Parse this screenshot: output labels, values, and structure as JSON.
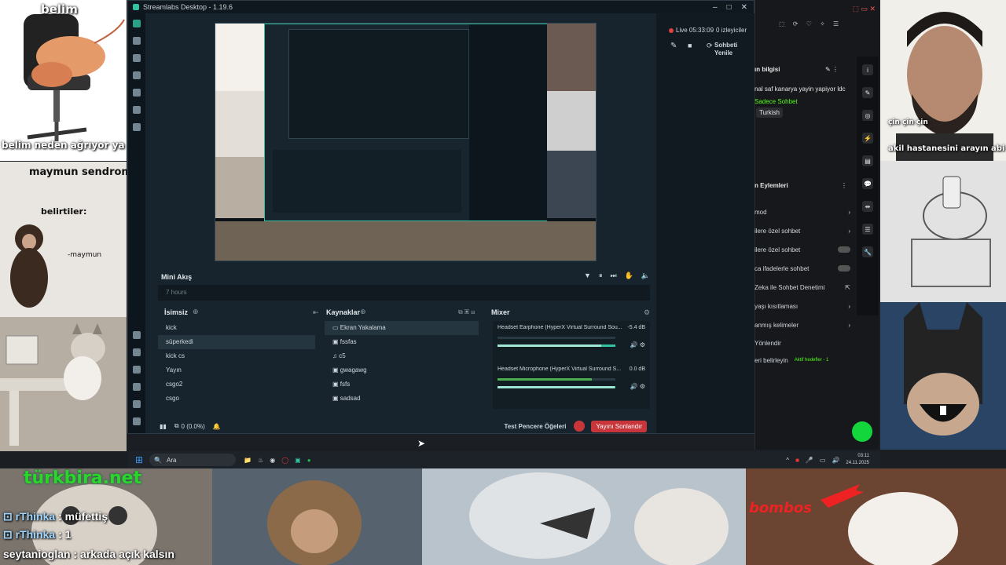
{
  "memes": {
    "shrimp_top": "belim",
    "shrimp_bottom": "belim neden ağrıyor ya",
    "monkey_title": "maymun sendromu",
    "monkey_symptoms": "belirtiler:",
    "monkey_sign": "-maymun",
    "turkbira": "türkbira.net",
    "bombos": "bombos",
    "akil": "akil hastanesini arayın abi",
    "cin": "çin çin çin"
  },
  "chat": [
    {
      "user": "rThinka",
      "msg": "müfettiş"
    },
    {
      "user": "rThinka",
      "msg": "1"
    },
    {
      "user": "seytanioglan",
      "msg": "arkada açık kalsın"
    }
  ],
  "app": {
    "title": "Streamlabs Desktop - 1.19.6",
    "live": "Live 05:33:09",
    "viewers": "0 izleyiciler",
    "refresh_chat": "Sohbeti Yenile"
  },
  "mini_feed": {
    "title": "Mini Akış",
    "empty_text": "7 hours"
  },
  "scenes": {
    "title": "İsimsiz",
    "items": [
      "kick",
      "süperkedi",
      "kick cs",
      "Yayın",
      "csgo2",
      "csgo"
    ]
  },
  "sources": {
    "title": "Kaynaklar",
    "items": [
      "Ekran Yakalama",
      "fssfas",
      "c5",
      "gwagawg",
      "fsfs",
      "sadsad"
    ]
  },
  "mixer": {
    "title": "Mixer",
    "channels": [
      {
        "name": "Headset Earphone (HyperX Virtual Surround Sou...",
        "db": "-5.4 dB",
        "level": 0.88
      },
      {
        "name": "Headset Microphone (HyperX Virtual Surround S...",
        "db": "0.0 dB",
        "level": 0.99
      }
    ]
  },
  "footer": {
    "cpu": "0 (0.0%)",
    "test_label": "Test Pencere Öğeleri",
    "stop_button": "Yayını Sonlandır"
  },
  "taskbar": {
    "search": "Ara",
    "time": "03:11",
    "date": "24.11.2025"
  },
  "kick": {
    "stream_info": "ın bilgisi",
    "stream_title": "nal saf kanarya yayin yapiyor ldc",
    "chat_only": "Sadece Sohbet",
    "language": "Turkish",
    "actions_title": "n Eylemleri",
    "rows": [
      {
        "label": "mod",
        "kind": "chevron"
      },
      {
        "label": "ilere özel sohbet",
        "kind": "chevron"
      },
      {
        "label": "ilere özel sohbet",
        "kind": "toggle"
      },
      {
        "label": "ca ifadelerle sohbet",
        "kind": "toggle"
      },
      {
        "label": "Zeka ile Sohbet Denetimi",
        "kind": "ext"
      },
      {
        "label": "yaşı kısıtlaması",
        "kind": "chevron"
      },
      {
        "label": "anmış kelimeler",
        "kind": "chevron"
      },
      {
        "label": "Yönlendir",
        "kind": "none"
      },
      {
        "label": "eri belirleyin",
        "kind": "chevron"
      }
    ],
    "goal": "Aktif hedefler - 1"
  },
  "colors": {
    "accent": "#31c3a2",
    "live_red": "#e04040",
    "kick_green": "#53fc18"
  }
}
